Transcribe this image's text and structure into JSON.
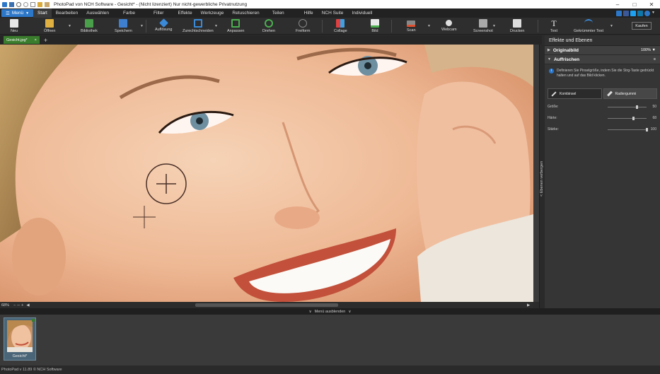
{
  "window": {
    "title": "PhotoPad von NCH Software - Gesicht* - (Nicht lizenziert) Nur nicht-gewerbliche Privatnutzung"
  },
  "menubar": {
    "menu_label": "Menü",
    "items": [
      "Start",
      "Bearbeiten",
      "Auswählen",
      "Farbe",
      "Filter",
      "Effekte",
      "Werkzeuge",
      "Retuschieren",
      "Teilen",
      "Hilfe",
      "NCH Suite",
      "Individuell"
    ],
    "active_index": 0
  },
  "toolbar": {
    "buttons": [
      "Neu",
      "Öffnen",
      "Bibliothek",
      "Speichern",
      "Auflösung",
      "Zurechtschneiden",
      "Anpassen",
      "Drehen",
      "Freiform",
      "Collage",
      "Bild",
      "Scan",
      "Webcam",
      "Screenshot",
      "Drucken",
      "Text",
      "Gekrümmter Text"
    ],
    "buy_label": "Kaufen"
  },
  "document": {
    "tab_label": "Gesicht.jpg*",
    "tab_close": "×",
    "add_tab": "+"
  },
  "canvas": {
    "zoom": "68%",
    "hide_menu_label": "Menü ausblenden",
    "layers_collapse_label": "< Ebenen verbergen"
  },
  "panel": {
    "title": "Effekte und Ebenen",
    "original_label": "Originalbild",
    "original_opacity": "100%",
    "section_label": "Auffrischen",
    "info_text": "Definieren Sie Pinselgröße, indem Sie die Strg-Taste gedrückt halten und auf das Bild klicken.",
    "modes": [
      {
        "label": "Kombinsel",
        "selected": false
      },
      {
        "label": "Radiergummi",
        "selected": true
      }
    ],
    "sliders": [
      {
        "label": "Größe:",
        "value": "50",
        "level": 0.75
      },
      {
        "label": "Härte:",
        "value": "68",
        "level": 0.66
      },
      {
        "label": "Stärke:",
        "value": "100",
        "level": 1.0
      }
    ]
  },
  "thumbnails": [
    {
      "label": "Gesicht*"
    }
  ],
  "status": {
    "text": "PhotoPad v 11.89 © NCH Software"
  },
  "colors": {
    "accent_blue": "#2d77c9",
    "tab_green": "#3a7d2c",
    "panel_bg": "#353535"
  }
}
